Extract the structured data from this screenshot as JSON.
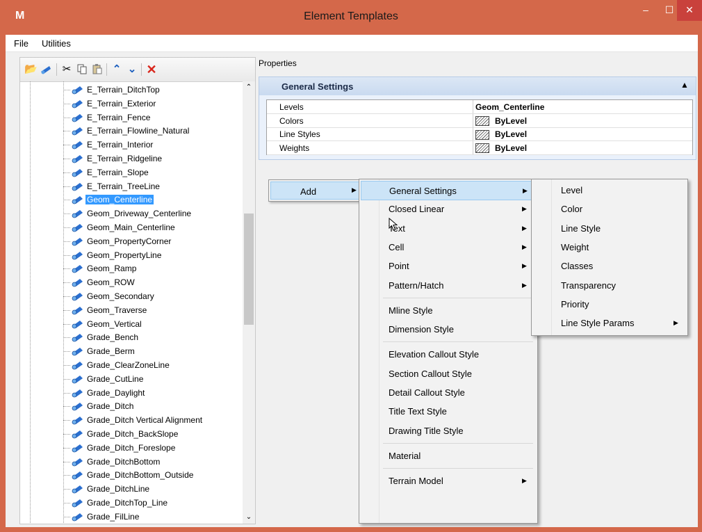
{
  "window": {
    "title": "Element Templates",
    "app_icon_glyph": "M",
    "minimize": "–",
    "maximize": "☐",
    "close": "✕"
  },
  "menubar": {
    "items": [
      "File",
      "Utilities"
    ]
  },
  "toolbar": {
    "icons": [
      "open-folder-icon",
      "template-icon",
      "cut-icon",
      "copy-icon",
      "paste-icon",
      "move-up-icon",
      "move-down-icon",
      "delete-icon"
    ]
  },
  "tree": {
    "items": [
      {
        "label": "E_Terrain_DitchTop"
      },
      {
        "label": "E_Terrain_Exterior"
      },
      {
        "label": "E_Terrain_Fence"
      },
      {
        "label": "E_Terrain_Flowline_Natural"
      },
      {
        "label": "E_Terrain_Interior"
      },
      {
        "label": "E_Terrain_Ridgeline"
      },
      {
        "label": "E_Terrain_Slope"
      },
      {
        "label": "E_Terrain_TreeLine"
      },
      {
        "label": "Geom_Centerline",
        "selected": true
      },
      {
        "label": "Geom_Driveway_Centerline"
      },
      {
        "label": "Geom_Main_Centerline"
      },
      {
        "label": "Geom_PropertyCorner"
      },
      {
        "label": "Geom_PropertyLine"
      },
      {
        "label": "Geom_Ramp"
      },
      {
        "label": "Geom_ROW"
      },
      {
        "label": "Geom_Secondary"
      },
      {
        "label": "Geom_Traverse"
      },
      {
        "label": "Geom_Vertical"
      },
      {
        "label": "Grade_Bench"
      },
      {
        "label": "Grade_Berm"
      },
      {
        "label": "Grade_ClearZoneLine"
      },
      {
        "label": "Grade_CutLine"
      },
      {
        "label": "Grade_Daylight"
      },
      {
        "label": "Grade_Ditch"
      },
      {
        "label": "Grade_Ditch Vertical Alignment"
      },
      {
        "label": "Grade_Ditch_BackSlope"
      },
      {
        "label": "Grade_Ditch_Foreslope"
      },
      {
        "label": "Grade_DitchBottom"
      },
      {
        "label": "Grade_DitchBottom_Outside"
      },
      {
        "label": "Grade_DitchLine"
      },
      {
        "label": "Grade_DitchTop_Line"
      },
      {
        "label": "Grade_FilLine"
      }
    ]
  },
  "properties": {
    "label": "Properties",
    "general_settings": {
      "title": "General Settings",
      "rows": [
        {
          "name": "Levels",
          "value": "Geom_Centerline",
          "swatch": false
        },
        {
          "name": "Colors",
          "value": "ByLevel",
          "swatch": true
        },
        {
          "name": "Line Styles",
          "value": "ByLevel",
          "swatch": true
        },
        {
          "name": "Weights",
          "value": "ByLevel",
          "swatch": true
        }
      ]
    }
  },
  "context_menu": {
    "add_label": "Add",
    "submenu": [
      {
        "label": "General Settings",
        "arrow": true,
        "highlighted": true
      },
      {
        "label": "Closed Linear",
        "arrow": true
      },
      {
        "label": "Text",
        "arrow": true
      },
      {
        "label": "Cell",
        "arrow": true
      },
      {
        "label": "Point",
        "arrow": true
      },
      {
        "label": "Pattern/Hatch",
        "arrow": true
      },
      {
        "separator": true
      },
      {
        "label": "Mline Style"
      },
      {
        "label": "Dimension Style"
      },
      {
        "separator": true
      },
      {
        "label": "Elevation Callout Style"
      },
      {
        "label": "Section Callout Style"
      },
      {
        "label": "Detail Callout Style"
      },
      {
        "label": "Title Text Style"
      },
      {
        "label": "Drawing Title Style"
      },
      {
        "separator": true
      },
      {
        "label": "Material"
      },
      {
        "separator": true
      },
      {
        "label": "Terrain Model",
        "arrow": true
      }
    ],
    "general_settings_submenu": [
      {
        "label": "Level"
      },
      {
        "label": "Color"
      },
      {
        "label": "Line Style"
      },
      {
        "label": "Weight"
      },
      {
        "label": "Classes"
      },
      {
        "label": "Transparency"
      },
      {
        "label": "Priority"
      },
      {
        "label": "Line Style Params",
        "arrow": true
      }
    ]
  },
  "colors": {
    "titlebar": "#d4684a",
    "selection": "#3399ff",
    "menu_highlight": "#cce4f7",
    "close_button": "#c9413c",
    "delete_icon": "#d9261c",
    "arrow_icons": "#1c5fbf"
  }
}
